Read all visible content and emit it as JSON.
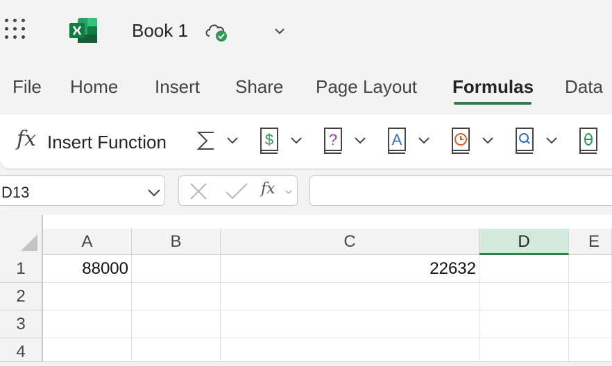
{
  "app": {
    "title": "Book 1"
  },
  "tabs": [
    "File",
    "Home",
    "Insert",
    "Share",
    "Page Layout",
    "Formulas",
    "Data"
  ],
  "active_tab": "Formulas",
  "ribbon": {
    "insert_function_label": "Insert Function",
    "icons": [
      "autosum-icon",
      "financial-icon",
      "logical-icon",
      "text-icon",
      "date-time-icon",
      "lookup-reference-icon",
      "math-trig-icon"
    ]
  },
  "formula_bar": {
    "name_box": "D13",
    "fx_label": "fx",
    "formula": ""
  },
  "grid": {
    "columns": [
      "A",
      "B",
      "C",
      "D",
      "E"
    ],
    "selected_column": "D",
    "rows": [
      "1",
      "2",
      "3",
      "4"
    ],
    "cells": {
      "A1": "88000",
      "C1": "22632"
    }
  },
  "colors": {
    "accent": "#2e7d4a",
    "selected_header": "#d2eadc"
  }
}
